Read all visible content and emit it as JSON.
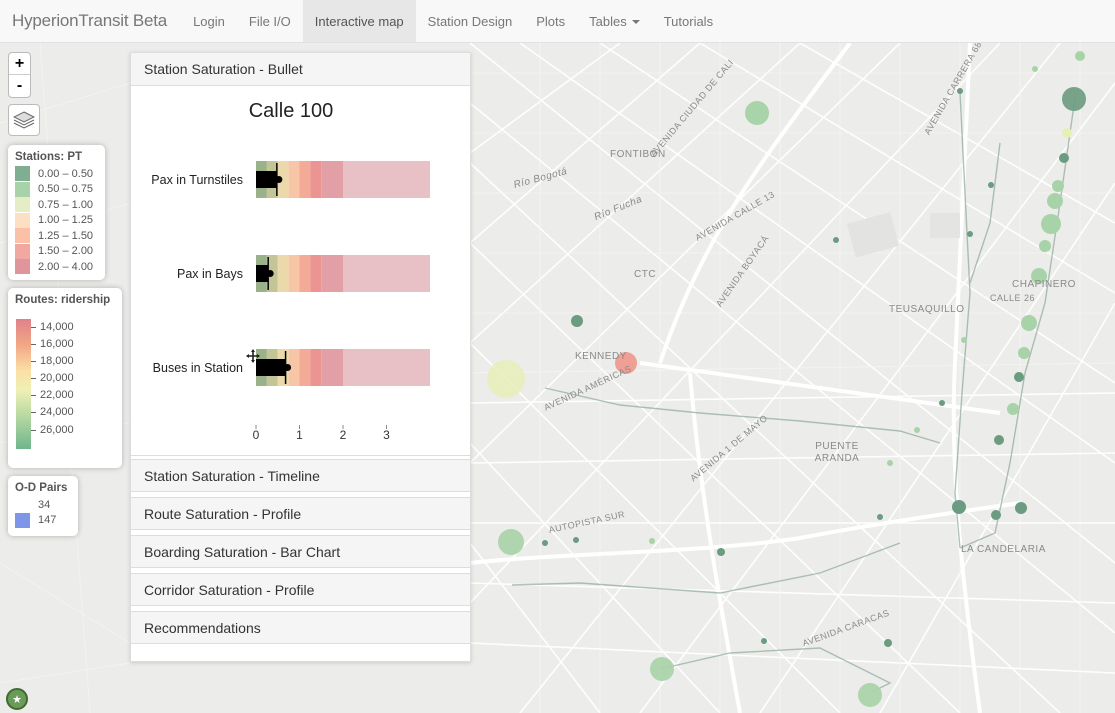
{
  "app": {
    "brand": "HyperionTransit Beta"
  },
  "nav": {
    "items": [
      {
        "label": "Login"
      },
      {
        "label": "File I/O"
      },
      {
        "label": "Interactive map"
      },
      {
        "label": "Station Design"
      },
      {
        "label": "Plots"
      },
      {
        "label": "Tables"
      },
      {
        "label": "Tutorials"
      }
    ],
    "active": "Interactive map"
  },
  "map_controls": {
    "zoom_in": "+",
    "zoom_out": "-"
  },
  "legend_stations": {
    "title": "Stations: PT",
    "items": [
      {
        "label": "0.00 – 0.50",
        "color": "#7fae92"
      },
      {
        "label": "0.50 – 0.75",
        "color": "#a8d3a8"
      },
      {
        "label": "0.75 – 1.00",
        "color": "#e4edc3"
      },
      {
        "label": "1.00 – 1.25",
        "color": "#fde0c2"
      },
      {
        "label": "1.25 – 1.50",
        "color": "#fbc1a8"
      },
      {
        "label": "1.50 – 2.00",
        "color": "#f1a8a0"
      },
      {
        "label": "2.00 – 4.00",
        "color": "#e0959d"
      }
    ]
  },
  "legend_routes": {
    "title": "Routes: ridership",
    "ticks": [
      "14,000",
      "16,000",
      "18,000",
      "20,000",
      "22,000",
      "24,000",
      "26,000"
    ]
  },
  "legend_od": {
    "title": "O-D Pairs",
    "items": [
      {
        "label": "34",
        "color": "#ffffff"
      },
      {
        "label": "147",
        "color": "#7d96ea"
      }
    ]
  },
  "map_labels": [
    "FONTIBÓN",
    "CTC",
    "KENNEDY",
    "TEUSAQUILLO",
    "CHAPINERO",
    "PUENTE ARANDA",
    "LA CANDELARIA",
    "Río Bogotá",
    "Río Fucha",
    "AVENIDA BOYACÁ",
    "AUTOPISTA SUR",
    "AVENIDA CARACAS",
    "AVENIDA 1 DE MAYO",
    "AVENIDA CIUDAD DE CALI",
    "AVENIDA AMÉRICAS",
    "AVENIDA CARRERA 68",
    "AVENIDA CALLE 13",
    "CALLE 26"
  ],
  "panel": {
    "sections": [
      "Station Saturation - Bullet",
      "Station Saturation - Timeline",
      "Route Saturation - Profile",
      "Boarding Saturation - Bar Chart",
      "Corridor Saturation - Profile",
      "Recommendations"
    ]
  },
  "chart_data": {
    "type": "bullet",
    "title": "Calle 100",
    "ranges": [
      0.25,
      0.5,
      0.75,
      1.0,
      1.25,
      1.5,
      2.0,
      4.0
    ],
    "range_colors": [
      "#9bb18a",
      "#c3c596",
      "#ebd8ab",
      "#f6c6a7",
      "#f3ab98",
      "#ec9491",
      "#e2a0a6",
      "#e8c1c6"
    ],
    "xlim": [
      0,
      4
    ],
    "ticks": [
      "0",
      "1",
      "2",
      "3"
    ],
    "rows": [
      {
        "label": "Pax in Turnstiles",
        "value": 0.48,
        "marker": 0.48
      },
      {
        "label": "Pax in Bays",
        "value": 0.28,
        "marker": 0.28
      },
      {
        "label": "Buses in Station",
        "value": 0.68,
        "marker": 0.68
      }
    ]
  }
}
